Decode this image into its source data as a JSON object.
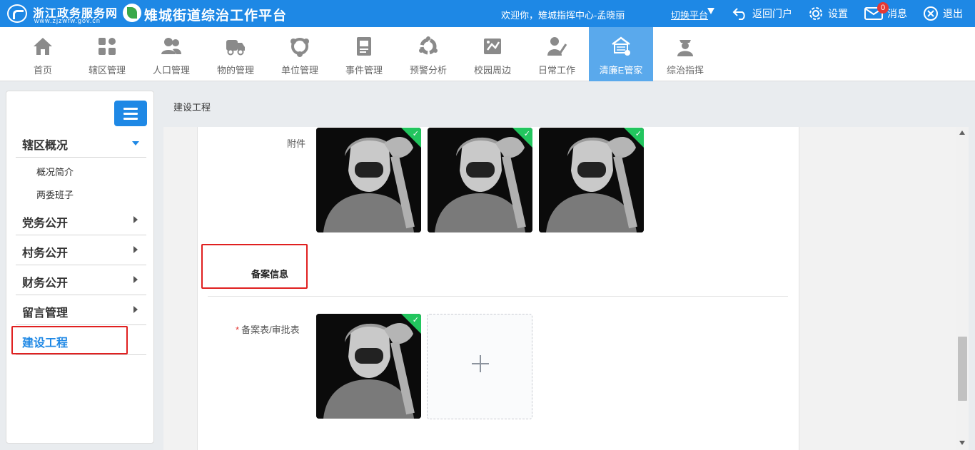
{
  "topbar": {
    "portal_name": "浙江政务服务网",
    "portal_url": "www.zjzwfw.gov.cn",
    "platform_title": "雉城街道综治工作平台",
    "welcome": "欢迎你，雉城指挥中心-孟晓丽",
    "switch_platform": "切换平台",
    "return_portal": "返回门户",
    "settings": "设置",
    "messages": "消息",
    "message_count": "0",
    "logout": "退出",
    "bg_color": "#1e88e5"
  },
  "nav": [
    {
      "label": "首页",
      "icon": "home-icon"
    },
    {
      "label": "辖区管理",
      "icon": "grid-blocks-icon"
    },
    {
      "label": "人口管理",
      "icon": "people-icon"
    },
    {
      "label": "物的管理",
      "icon": "truck-icon"
    },
    {
      "label": "单位管理",
      "icon": "network-icon"
    },
    {
      "label": "事件管理",
      "icon": "notebook-icon"
    },
    {
      "label": "预警分析",
      "icon": "cycle-icon"
    },
    {
      "label": "校园周边",
      "icon": "school-icon"
    },
    {
      "label": "日常工作",
      "icon": "user-pen-icon"
    },
    {
      "label": "清廉E管家",
      "icon": "clean-house-icon",
      "active": true
    },
    {
      "label": "综治指挥",
      "icon": "officer-icon"
    }
  ],
  "sidebar": {
    "sections": [
      {
        "label": "辖区概况",
        "expanded": true,
        "children": [
          "概况简介",
          "两委班子"
        ]
      },
      {
        "label": "党务公开"
      },
      {
        "label": "村务公开"
      },
      {
        "label": "财务公开"
      },
      {
        "label": "留言管理"
      },
      {
        "label": "建设工程",
        "active": true
      }
    ]
  },
  "breadcrumb": "建设工程",
  "form": {
    "attachments_label": "附件",
    "attachment_count": 3,
    "section_title": "备案信息",
    "record_label": "备案表/审批表",
    "record_required_mark": "*",
    "record_file_count": 1
  },
  "colors": {
    "accent": "#1e88e5",
    "nav_active": "#5aa9ec",
    "highlight_box": "#e02020",
    "upload_ok": "#22c55e"
  }
}
